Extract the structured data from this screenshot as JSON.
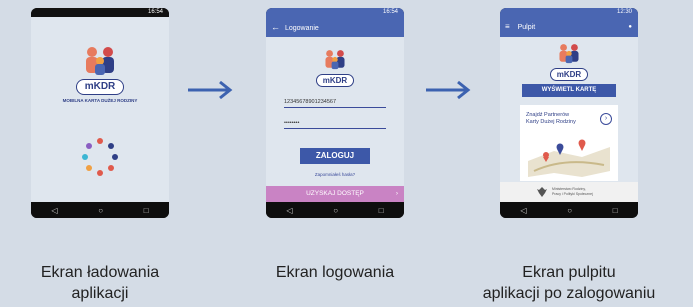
{
  "status_time": "16:54",
  "status_time_3": "12:30",
  "screen1": {
    "logo_text": "mKDR",
    "subtitle": "MOBILNA KARTA DUŻEJ RODZINY",
    "caption_line1": "Ekran ładowania",
    "caption_line2": "aplikacji"
  },
  "screen2": {
    "title": "Logowanie",
    "logo_text": "mKDR",
    "login_value": "12345678901234567",
    "password_value": "••••••••",
    "login_button": "ZALOGUJ",
    "forgot_link": "Zapomniałeś hasła?",
    "access_button": "UZYSKAJ DOSTĘP",
    "caption": "Ekran logowania"
  },
  "screen3": {
    "title": "Pulpit",
    "logo_text": "mKDR",
    "show_card_button": "WYŚWIETL KARTĘ",
    "partners_line1": "Znajdź Partnerów",
    "partners_line2": "Karty Dużej Rodziny",
    "ministry_line1": "Ministerstwo Rodziny,",
    "ministry_line2": "Pracy i Polityki Społecznej",
    "caption_line1": "Ekran pulpitu",
    "caption_line2": "aplikacji po zalogowaniu"
  },
  "navbar": {
    "back": "◁",
    "home": "○",
    "recent": "□"
  }
}
